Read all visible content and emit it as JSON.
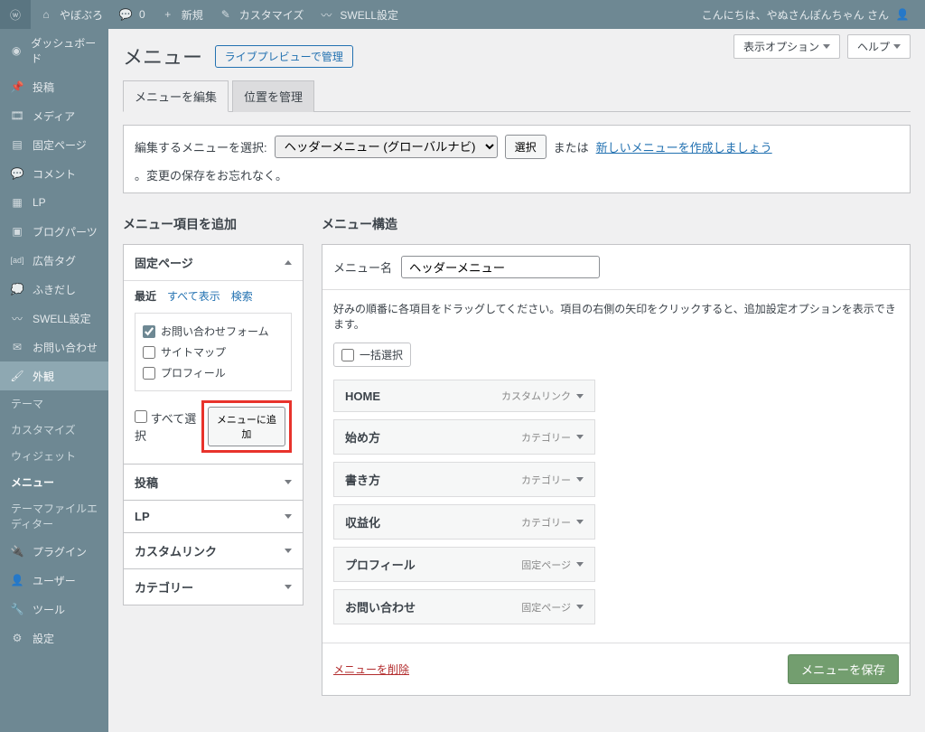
{
  "adminbar": {
    "site_name": "やぼぶろ",
    "comments_count": "0",
    "new_label": "新規",
    "customize_label": "カスタマイズ",
    "swell_label": "SWELL設定",
    "greeting": "こんにちは、やぬさんぽんちゃん さん"
  },
  "sidebar": {
    "items": [
      {
        "label": "ダッシュボード"
      },
      {
        "label": "投稿"
      },
      {
        "label": "メディア"
      },
      {
        "label": "固定ページ"
      },
      {
        "label": "コメント"
      },
      {
        "label": "LP"
      },
      {
        "label": "ブログパーツ"
      },
      {
        "label": "広告タグ"
      },
      {
        "label": "ふきだし"
      },
      {
        "label": "SWELL設定"
      },
      {
        "label": "お問い合わせ"
      },
      {
        "label": "外観"
      },
      {
        "label": "プラグイン"
      },
      {
        "label": "ユーザー"
      },
      {
        "label": "ツール"
      },
      {
        "label": "設定"
      }
    ],
    "sub": {
      "theme": "テーマ",
      "customize": "カスタマイズ",
      "widget": "ウィジェット",
      "menu": "メニュー",
      "tfe": "テーマファイルエディター"
    }
  },
  "top_right": {
    "screen_options": "表示オプション",
    "help": "ヘルプ"
  },
  "heading": {
    "title": "メニュー",
    "live_preview": "ライブプレビューで管理"
  },
  "tabs": {
    "edit": "メニューを編集",
    "locations": "位置を管理"
  },
  "selector": {
    "label": "編集するメニューを選択:",
    "selected": "ヘッダーメニュー (グローバルナビ)",
    "select_btn": "選択",
    "or": "または",
    "create_link": "新しいメニューを作成しましょう",
    "dont_forget": "。変更の保存をお忘れなく。"
  },
  "left_col": {
    "heading": "メニュー項目を追加",
    "panels": {
      "pages": "固定ページ",
      "posts": "投稿",
      "lp": "LP",
      "custom": "カスタムリンク",
      "category": "カテゴリー"
    },
    "pages_tabs": {
      "recent": "最近",
      "all": "すべて表示",
      "search": "検索"
    },
    "pages_items": [
      {
        "label": "お問い合わせフォーム",
        "checked": true
      },
      {
        "label": "サイトマップ",
        "checked": false
      },
      {
        "label": "プロフィール",
        "checked": false
      }
    ],
    "select_all": "すべて選択",
    "add_to_menu": "メニューに追加"
  },
  "right_col": {
    "heading": "メニュー構造",
    "name_label": "メニュー名",
    "name_value": "ヘッダーメニュー",
    "hint": "好みの順番に各項目をドラッグしてください。項目の右側の矢印をクリックすると、追加設定オプションを表示できます。",
    "bulk_select": "一括選択",
    "items": [
      {
        "label": "HOME",
        "type": "カスタムリンク"
      },
      {
        "label": "始め方",
        "type": "カテゴリー"
      },
      {
        "label": "書き方",
        "type": "カテゴリー"
      },
      {
        "label": "収益化",
        "type": "カテゴリー"
      },
      {
        "label": "プロフィール",
        "type": "固定ページ"
      },
      {
        "label": "お問い合わせ",
        "type": "固定ページ"
      }
    ],
    "delete_menu": "メニューを削除",
    "save_menu": "メニューを保存"
  }
}
